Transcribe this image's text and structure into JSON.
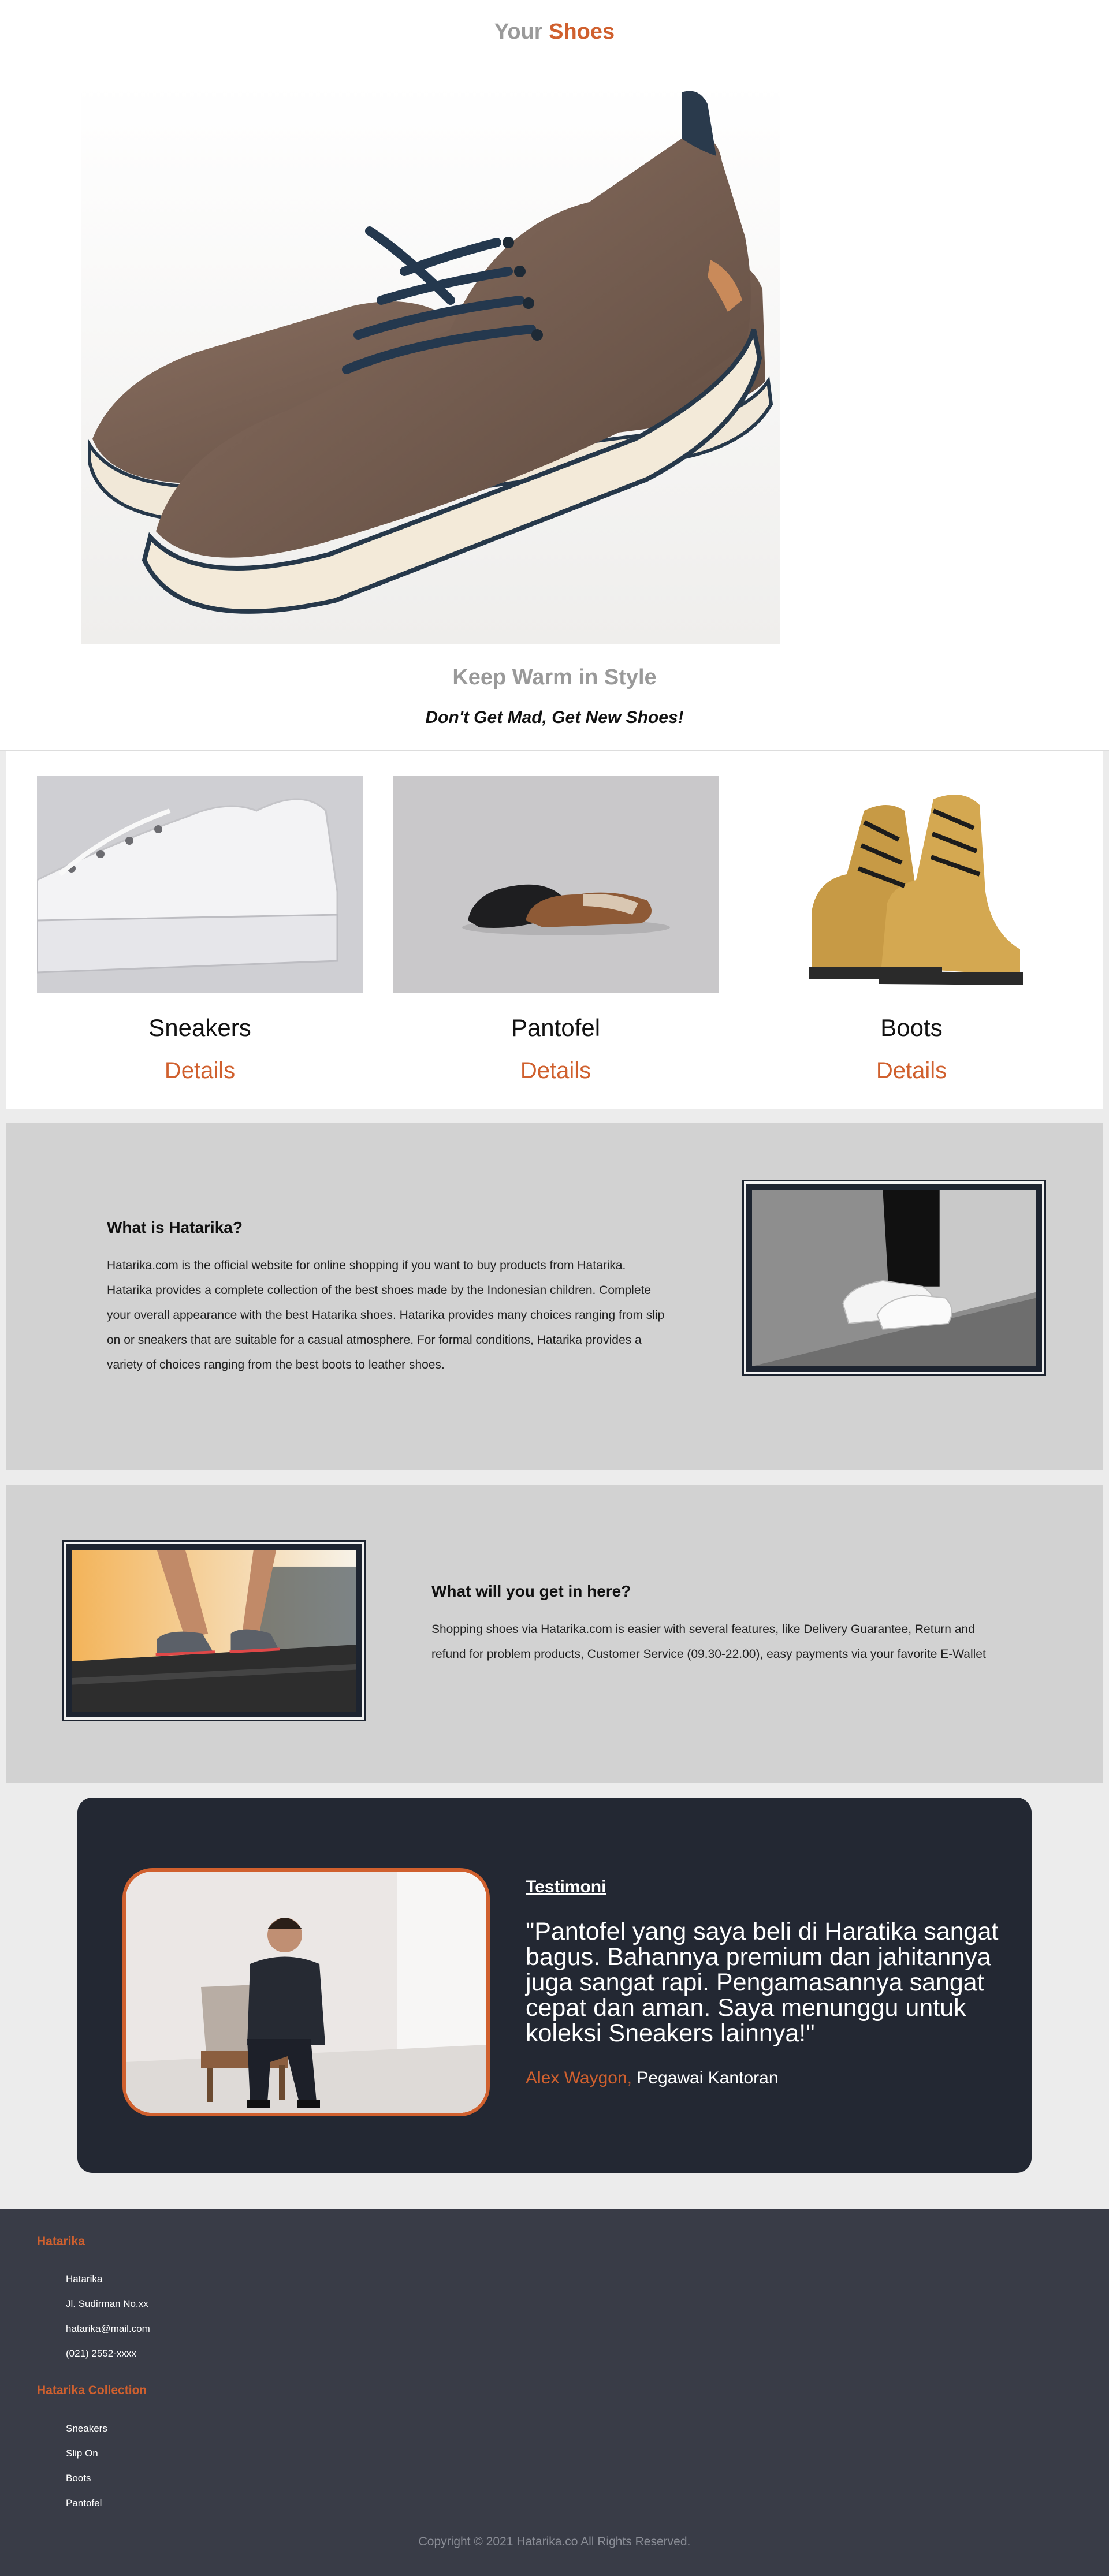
{
  "colors": {
    "accent": "#d0602e",
    "muted": "#9a9a9a",
    "section_bg": "#d2d2d2",
    "testimonial_bg": "#232833",
    "footer_bg": "#393c47"
  },
  "header": {
    "brand_first": "Your",
    "brand_second": "Shoes"
  },
  "hero": {
    "title": "Keep Warm in Style",
    "subtitle": "Don't Get Mad, Get New Shoes!"
  },
  "categories": [
    {
      "name": "Sneakers",
      "link": "Details"
    },
    {
      "name": "Pantofel",
      "link": "Details"
    },
    {
      "name": "Boots",
      "link": "Details"
    }
  ],
  "about": {
    "heading": "What is Hatarika?",
    "text": "Hatarika.com is the official website for online shopping if you want to buy products from Hatarika. Hatarika provides a complete collection of the best shoes made by the Indonesian children. Complete your overall appearance with the best Hatarika shoes. Hatarika provides many choices ranging from slip on or sneakers that are suitable for a casual atmosphere. For formal conditions, Hatarika provides a variety of choices ranging from the best boots to leather shoes."
  },
  "benefits": {
    "heading": "What will you get in here?",
    "text": "Shopping shoes via Hatarika.com is easier with several features, like Delivery Guarantee, Return and refund for problem products, Customer Service (09.30-22.00), easy payments via your favorite E-Wallet"
  },
  "testimonial": {
    "label": "Testimoni",
    "quote": "\"Pantofel yang saya beli di Haratika sangat bagus. Bahannya premium dan jahitannya juga sangat rapi. Pengamasannya sangat cepat dan aman. Saya menunggu untuk koleksi Sneakers lainnya!\"",
    "author_name": "Alex Waygon,",
    "author_role": "Pegawai Kantoran"
  },
  "footer": {
    "contact_heading": "Hatarika",
    "contact_items": [
      "Hatarika",
      "Jl. Sudirman No.xx",
      "hatarika@mail.com",
      "(021) 2552-xxxx"
    ],
    "collection_heading": "Hatarika Collection",
    "collection_items": [
      "Sneakers",
      "Slip On",
      "Boots",
      "Pantofel"
    ],
    "copyright": "Copyright © 2021 Hatarika.co All Rights Reserved."
  }
}
